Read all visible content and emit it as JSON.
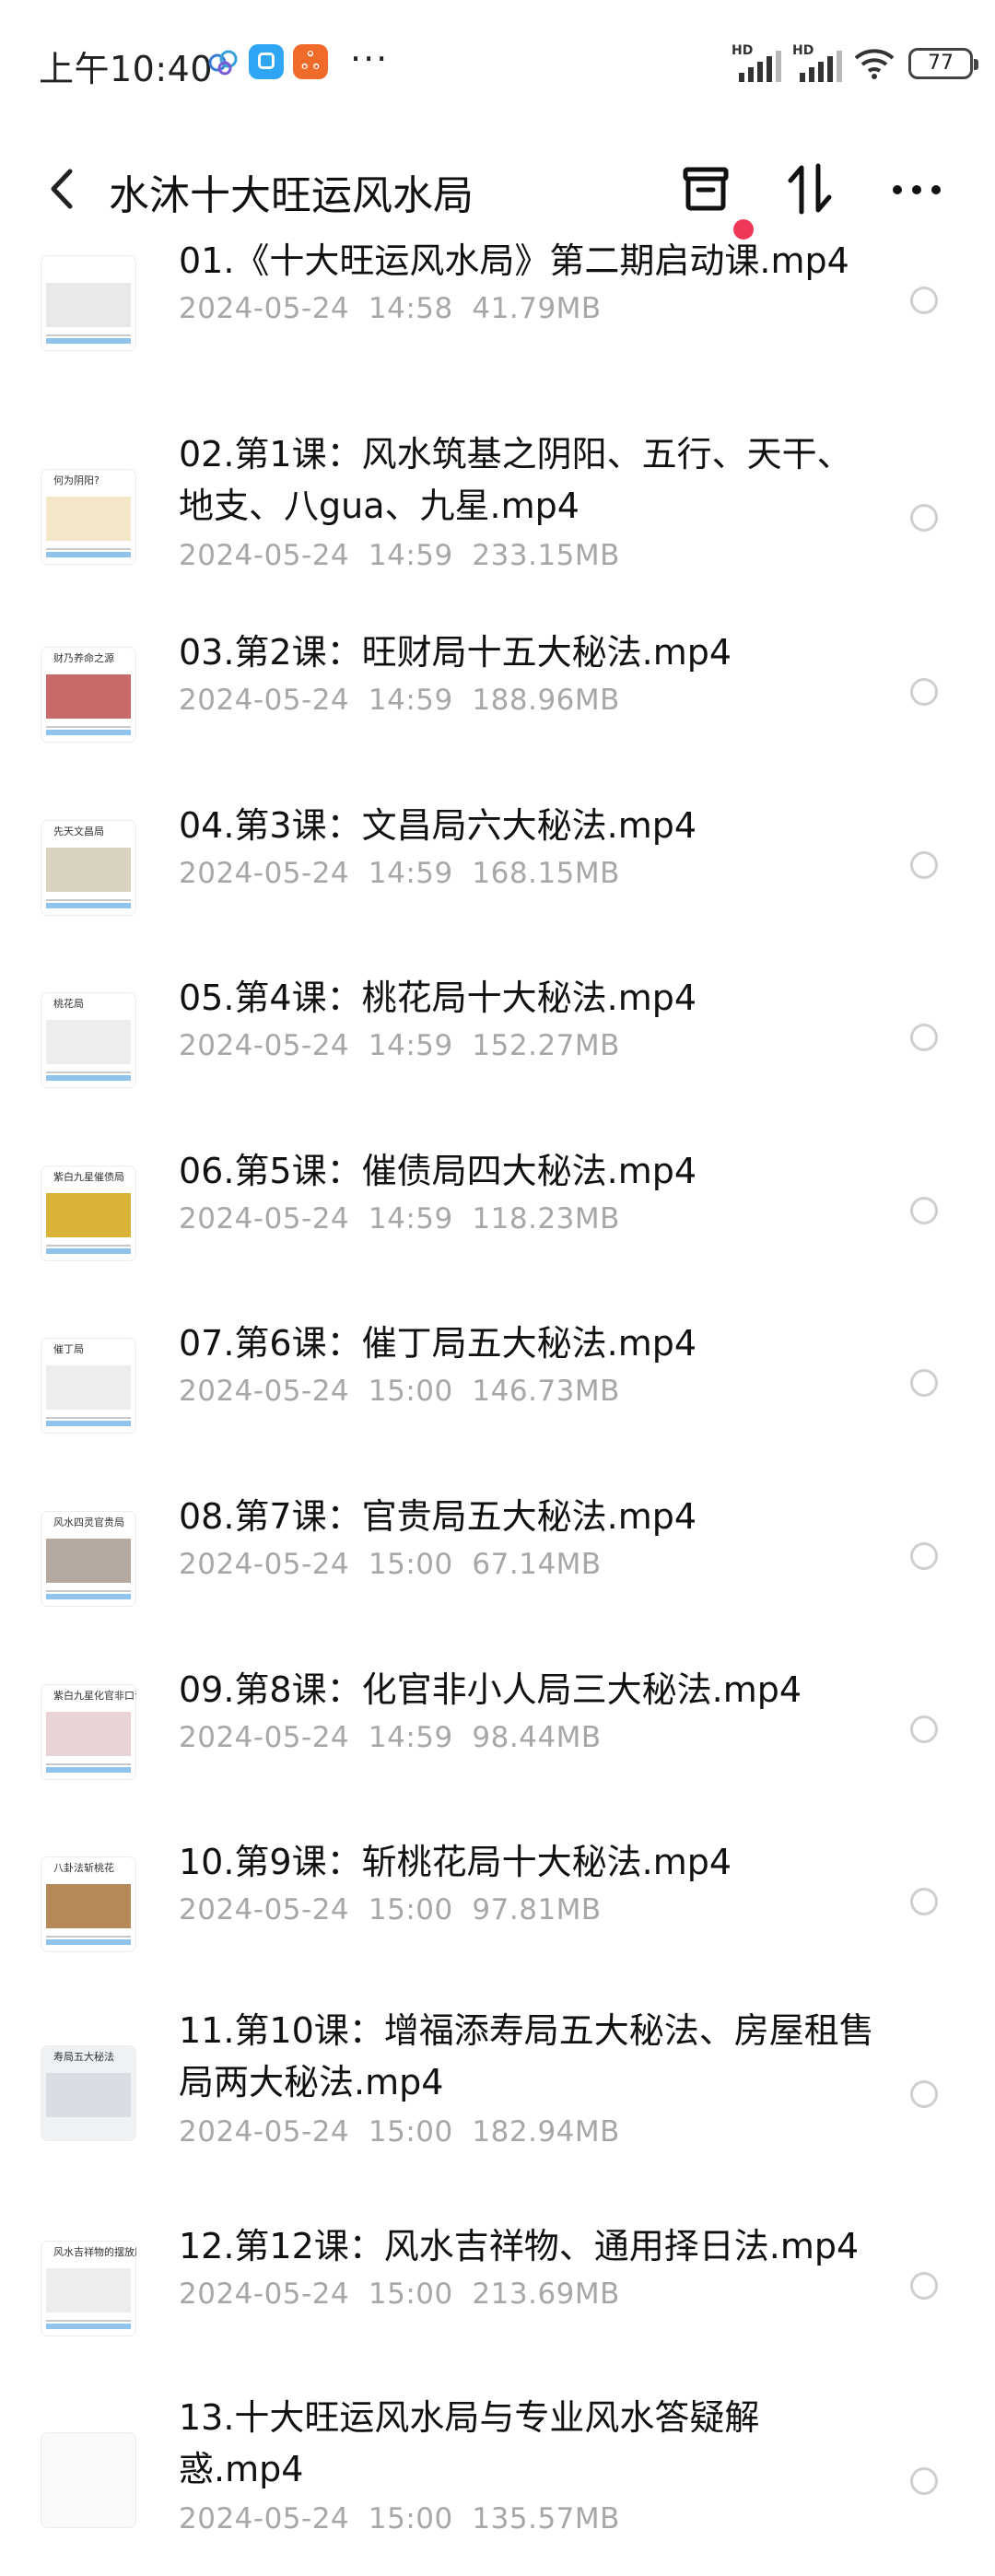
{
  "status_bar": {
    "time": "上午10:40",
    "notif3_text": "ஃ",
    "more_dots": "···",
    "sim1": "HD",
    "sim2": "HD",
    "battery": "77"
  },
  "header": {
    "title": "水沐十大旺运风水局",
    "badge_color": "#f0375a"
  },
  "files": [
    {
      "name": "01.《十大旺运风水局》第二期启动课.mp4",
      "date": "2024-05-24",
      "time": "14:58",
      "size": "41.79MB",
      "thumb": "table"
    },
    {
      "name": "02.第1课：风水筑基之阴阳、五行、天干、地支、八gua、九星.mp4",
      "date": "2024-05-24",
      "time": "14:59",
      "size": "233.15MB",
      "thumb": "diagram",
      "thumb_title": "何为阴阳?"
    },
    {
      "name": "03.第2课：旺财局十五大秘法.mp4",
      "date": "2024-05-24",
      "time": "14:59",
      "size": "188.96MB",
      "thumb": "photo-red",
      "thumb_title": "财乃养命之源"
    },
    {
      "name": "04.第3课：文昌局六大秘法.mp4",
      "date": "2024-05-24",
      "time": "14:59",
      "size": "168.15MB",
      "thumb": "plan",
      "thumb_title": "先天文昌局"
    },
    {
      "name": "05.第4课：桃花局十大秘法.mp4",
      "date": "2024-05-24",
      "time": "14:59",
      "size": "152.27MB",
      "thumb": "text",
      "thumb_title": "桃花局"
    },
    {
      "name": "06.第5课：催债局四大秘法.mp4",
      "date": "2024-05-24",
      "time": "14:59",
      "size": "118.23MB",
      "thumb": "photo-yellow",
      "thumb_title": "紫白九星催债局"
    },
    {
      "name": "07.第6课：催丁局五大秘法.mp4",
      "date": "2024-05-24",
      "time": "15:00",
      "size": "146.73MB",
      "thumb": "text",
      "thumb_title": "催丁局"
    },
    {
      "name": "08.第7课：官贵局五大秘法.mp4",
      "date": "2024-05-24",
      "time": "15:00",
      "size": "67.14MB",
      "thumb": "photo-room",
      "thumb_title": "风水四灵官贵局"
    },
    {
      "name": "09.第8课：化官非小人局三大秘法.mp4",
      "date": "2024-05-24",
      "time": "14:59",
      "size": "98.44MB",
      "thumb": "photo-flower",
      "thumb_title": "紫白九星化官非口舌局"
    },
    {
      "name": "10.第9课：斩桃花局十大秘法.mp4",
      "date": "2024-05-24",
      "time": "15:00",
      "size": "97.81MB",
      "thumb": "photo-mix",
      "thumb_title": "八卦法斩桃花"
    },
    {
      "name": "11.第10课：增福添寿局五大秘法、房屋租售局两大秘法.mp4",
      "date": "2024-05-24",
      "time": "15:00",
      "size": "182.94MB",
      "thumb": "person",
      "thumb_title": "寿局五大秘法"
    },
    {
      "name": "12.第12课：风水吉祥物、通用择日法.mp4",
      "date": "2024-05-24",
      "time": "15:00",
      "size": "213.69MB",
      "thumb": "text",
      "thumb_title": "风水吉祥物的摆放原则"
    },
    {
      "name": "13.十大旺运风水局与专业风水答疑解惑.mp4",
      "date": "2024-05-24",
      "time": "15:00",
      "size": "135.57MB",
      "thumb": "blank"
    }
  ]
}
